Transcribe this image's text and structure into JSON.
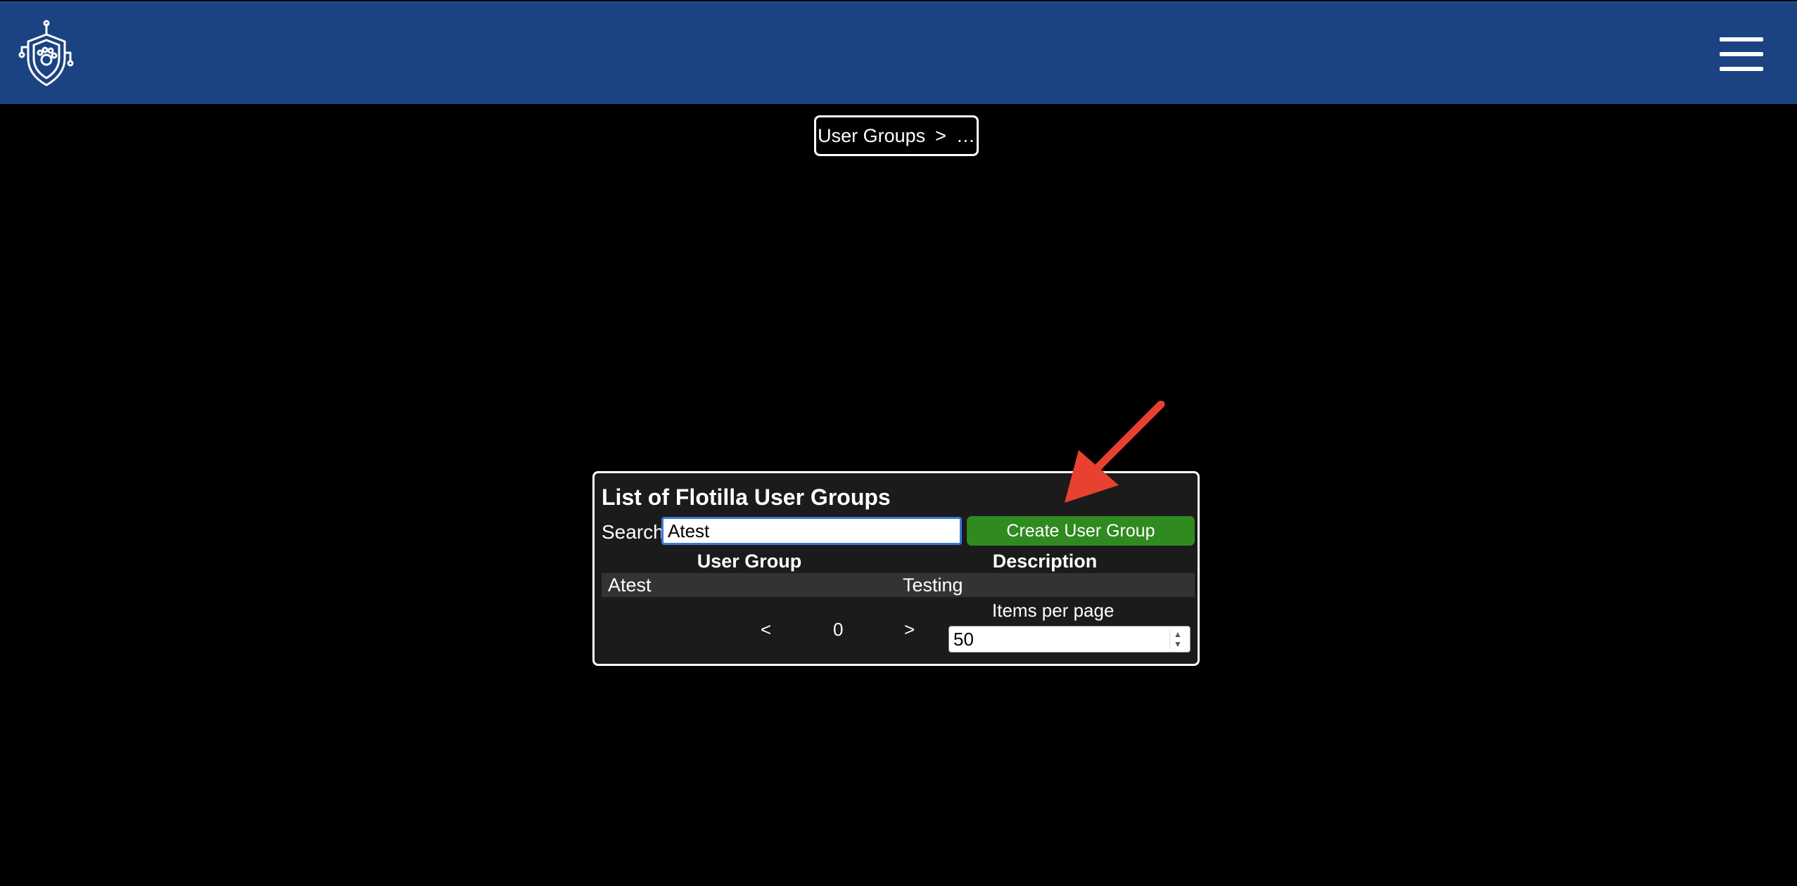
{
  "header": {
    "logo_icon": "shield-paw-circuit-logo",
    "menu_icon": "hamburger-menu-icon",
    "background": "#1b4382"
  },
  "breadcrumb": {
    "item": "User Groups",
    "separator": ">",
    "ellipsis": "…"
  },
  "panel": {
    "title": "List of Flotilla User Groups",
    "search_label": "Search",
    "search_value": "Atest",
    "create_button": "Create User Group",
    "columns": [
      "User Group",
      "Description"
    ],
    "rows": [
      {
        "user_group": "Atest",
        "description": "Testing"
      }
    ],
    "pager": {
      "prev": "<",
      "page": "0",
      "next": ">"
    },
    "items_per_page_label": "Items per page",
    "items_per_page_value": "50"
  },
  "annotation": {
    "arrow_color": "#e8412f"
  }
}
